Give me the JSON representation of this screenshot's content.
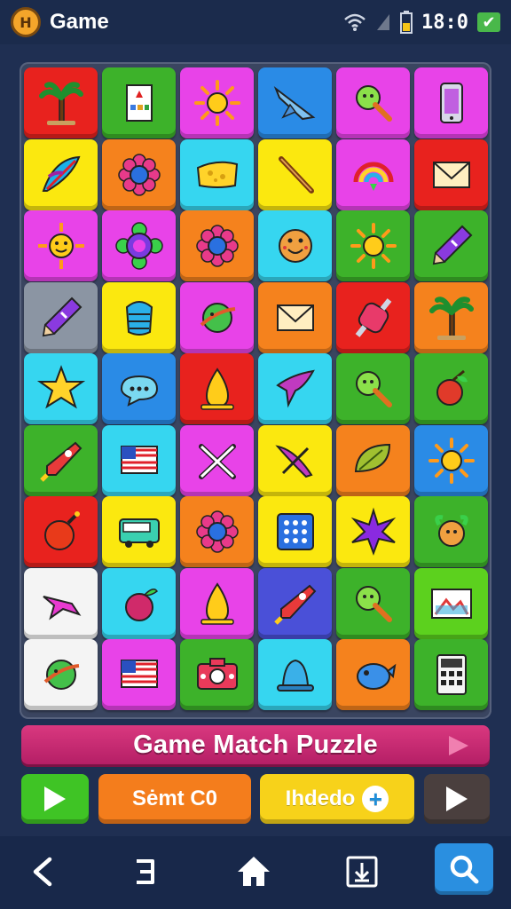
{
  "status_bar": {
    "logo_text": "H",
    "app_title": "Game",
    "time": "18:0",
    "icons": [
      "wifi-icon",
      "signal-icon",
      "battery-icon",
      "checkmark-icon"
    ]
  },
  "colors": {
    "red": "#e8221e",
    "green": "#3db22a",
    "magenta": "#e843e8",
    "blue": "#2a8be6",
    "yellow": "#fbe80f",
    "cyan": "#36d6f0",
    "orange": "#f5821d",
    "gray": "#8b95a3",
    "white": "#f4f4f4",
    "indigo": "#4a50d8",
    "lime": "#5cd11e"
  },
  "board": {
    "rows": [
      [
        {
          "color": "red",
          "icon": "palm-tree-icon"
        },
        {
          "color": "green",
          "icon": "card-icon"
        },
        {
          "color": "magenta",
          "icon": "sun-icon"
        },
        {
          "color": "blue",
          "icon": "jet-icon"
        },
        {
          "color": "magenta",
          "icon": "lollipop-icon"
        },
        {
          "color": "magenta",
          "icon": "phone-icon"
        }
      ],
      [
        {
          "color": "yellow",
          "icon": "feather-icon"
        },
        {
          "color": "orange",
          "icon": "flower-icon"
        },
        {
          "color": "cyan",
          "icon": "cheese-icon"
        },
        {
          "color": "yellow",
          "icon": "wand-icon"
        },
        {
          "color": "magenta",
          "icon": "rainbow-icon"
        },
        {
          "color": "red",
          "icon": "envelope-icon"
        }
      ],
      [
        {
          "color": "magenta",
          "icon": "sun-face-icon"
        },
        {
          "color": "magenta",
          "icon": "ring-flower-icon"
        },
        {
          "color": "orange",
          "icon": "flower-icon"
        },
        {
          "color": "cyan",
          "icon": "cookie-icon"
        },
        {
          "color": "green",
          "icon": "sun-icon"
        },
        {
          "color": "green",
          "icon": "crayon-icon"
        }
      ],
      [
        {
          "color": "gray",
          "icon": "crayon-icon"
        },
        {
          "color": "yellow",
          "icon": "lantern-icon"
        },
        {
          "color": "magenta",
          "icon": "planet-icon"
        },
        {
          "color": "orange",
          "icon": "envelope-icon"
        },
        {
          "color": "red",
          "icon": "candy-icon"
        },
        {
          "color": "orange",
          "icon": "palm-tree-icon"
        }
      ],
      [
        {
          "color": "cyan",
          "icon": "star-icon"
        },
        {
          "color": "blue",
          "icon": "chat-bubble-icon"
        },
        {
          "color": "red",
          "icon": "flame-icon"
        },
        {
          "color": "cyan",
          "icon": "bird-icon"
        },
        {
          "color": "green",
          "icon": "lollipop-icon"
        },
        {
          "color": "green",
          "icon": "fruit-icon"
        }
      ],
      [
        {
          "color": "green",
          "icon": "rocket-icon"
        },
        {
          "color": "cyan",
          "icon": "flag-icon"
        },
        {
          "color": "magenta",
          "icon": "crossed-sticks-icon"
        },
        {
          "color": "yellow",
          "icon": "dart-icon"
        },
        {
          "color": "orange",
          "icon": "leaf-icon"
        },
        {
          "color": "blue",
          "icon": "sun-icon"
        }
      ],
      [
        {
          "color": "red",
          "icon": "bomb-icon"
        },
        {
          "color": "yellow",
          "icon": "bus-icon"
        },
        {
          "color": "orange",
          "icon": "flower-icon"
        },
        {
          "color": "yellow",
          "icon": "dice-icon"
        },
        {
          "color": "yellow",
          "icon": "burst-icon"
        },
        {
          "color": "green",
          "icon": "turtle-icon"
        }
      ],
      [
        {
          "color": "white",
          "icon": "plane-icon"
        },
        {
          "color": "cyan",
          "icon": "berry-icon"
        },
        {
          "color": "magenta",
          "icon": "flame-icon"
        },
        {
          "color": "indigo",
          "icon": "rocket-icon"
        },
        {
          "color": "green",
          "icon": "lollipop-icon"
        },
        {
          "color": "lime",
          "icon": "picture-icon"
        }
      ],
      [
        {
          "color": "white",
          "icon": "planet-icon"
        },
        {
          "color": "magenta",
          "icon": "flag-icon"
        },
        {
          "color": "green",
          "icon": "camera-icon"
        },
        {
          "color": "cyan",
          "icon": "bell-icon"
        },
        {
          "color": "orange",
          "icon": "fish-icon"
        },
        {
          "color": "green",
          "icon": "calculator-icon"
        }
      ]
    ]
  },
  "banner": {
    "title": "Game Match Puzzle"
  },
  "controls": {
    "score_label": "Sėmt C0",
    "hint_label": "Ihdedo",
    "hint_plus": "+"
  },
  "nav": {
    "icons": [
      "back-icon",
      "recents-icon",
      "home-icon",
      "download-icon",
      "search-icon"
    ]
  }
}
